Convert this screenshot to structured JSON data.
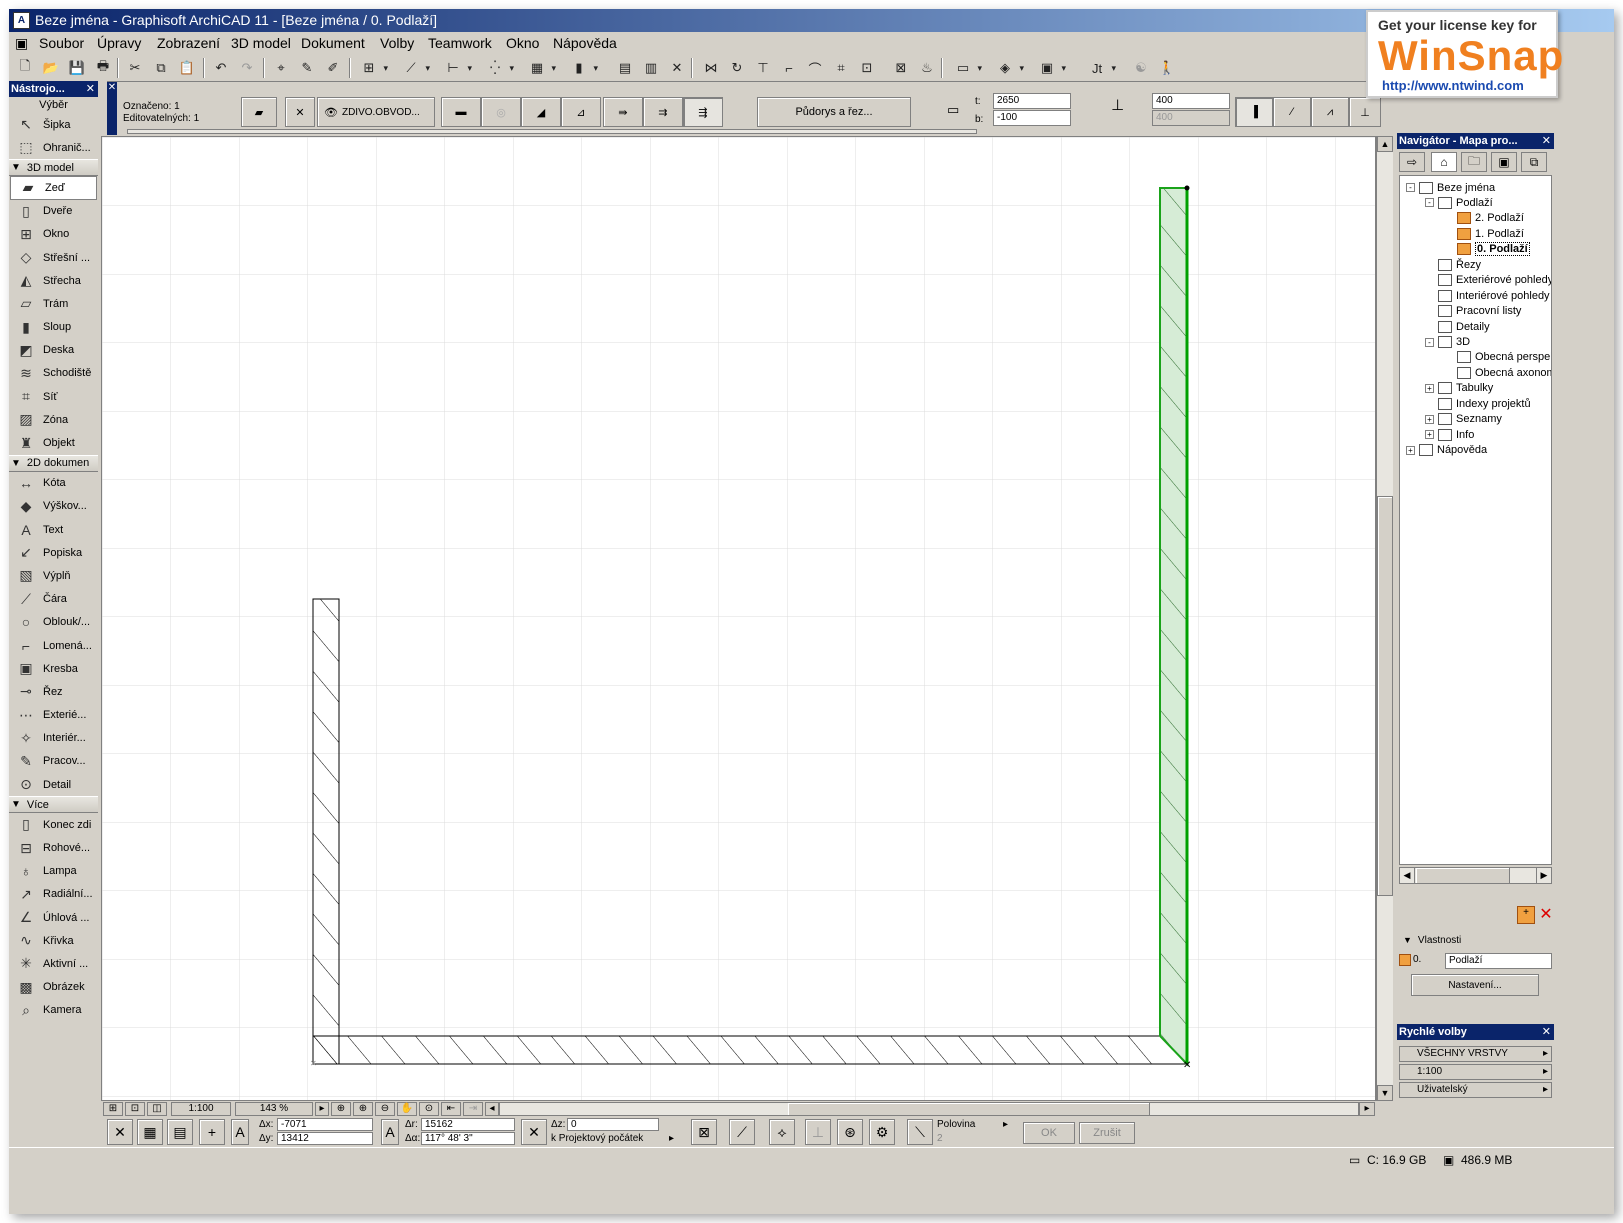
{
  "window": {
    "title": "Beze jména - Graphisoft ArchiCAD 11 - [Beze jména / 0. Podlaží]"
  },
  "menu": [
    "Soubor",
    "Úpravy",
    "Zobrazení",
    "3D model",
    "Dokument",
    "Volby",
    "Teamwork",
    "Okno",
    "Nápověda"
  ],
  "infobox": {
    "selected": "Označeno: 1",
    "editable": "Editovatelných: 1",
    "material": "ZDIVO.OBVOD...",
    "view_button": "Půdorys a řez...",
    "top_label": "t:",
    "top_value": "2650",
    "bottom_label": "b:",
    "bottom_value": "-100",
    "height_value": "400",
    "height_value2": "400"
  },
  "toolbox": {
    "title": "Nástrojo...",
    "select_label": "Výběr",
    "groups": {
      "selection": [
        {
          "label": "Šipka",
          "icon": "arrow-icon"
        },
        {
          "label": "Ohranič...",
          "icon": "marquee-icon"
        }
      ],
      "model_header": "3D model",
      "model": [
        {
          "label": "Zeď",
          "icon": "wall-icon",
          "selected": true
        },
        {
          "label": "Dveře",
          "icon": "door-icon"
        },
        {
          "label": "Okno",
          "icon": "window-icon"
        },
        {
          "label": "Střešní ...",
          "icon": "roof-window-icon"
        },
        {
          "label": "Střecha",
          "icon": "roof-icon"
        },
        {
          "label": "Trám",
          "icon": "beam-icon"
        },
        {
          "label": "Sloup",
          "icon": "column-icon"
        },
        {
          "label": "Deska",
          "icon": "slab-icon"
        },
        {
          "label": "Schodiště",
          "icon": "stair-icon"
        },
        {
          "label": "Síť",
          "icon": "mesh-icon"
        },
        {
          "label": "Zóna",
          "icon": "zone-icon"
        },
        {
          "label": "Objekt",
          "icon": "object-icon"
        }
      ],
      "doc_header": "2D dokumen",
      "doc": [
        {
          "label": "Kóta",
          "icon": "dimension-icon"
        },
        {
          "label": "Výškov...",
          "icon": "level-dimension-icon"
        },
        {
          "label": "Text",
          "icon": "text-icon"
        },
        {
          "label": "Popiska",
          "icon": "label-icon"
        },
        {
          "label": "Výplň",
          "icon": "fill-icon"
        },
        {
          "label": "Čára",
          "icon": "line-icon"
        },
        {
          "label": "Oblouk/...",
          "icon": "arc-icon"
        },
        {
          "label": "Lomená...",
          "icon": "polyline-icon"
        },
        {
          "label": "Kresba",
          "icon": "drawing-icon"
        },
        {
          "label": "Řez",
          "icon": "section-icon"
        },
        {
          "label": "Exterié...",
          "icon": "elevation-icon"
        },
        {
          "label": "Interiér...",
          "icon": "interior-elevation-icon"
        },
        {
          "label": "Pracov...",
          "icon": "worksheet-icon"
        },
        {
          "label": "Detail",
          "icon": "detail-icon"
        }
      ],
      "more_header": "Více",
      "more": [
        {
          "label": "Konec zdi",
          "icon": "wall-end-icon"
        },
        {
          "label": "Rohové...",
          "icon": "corner-window-icon"
        },
        {
          "label": "Lampa",
          "icon": "lamp-icon"
        },
        {
          "label": "Radiální...",
          "icon": "radial-dimension-icon"
        },
        {
          "label": "Úhlová ...",
          "icon": "angle-dimension-icon"
        },
        {
          "label": "Křivka",
          "icon": "spline-icon"
        },
        {
          "label": "Aktivní ...",
          "icon": "hotspot-icon"
        },
        {
          "label": "Obrázek",
          "icon": "picture-icon"
        },
        {
          "label": "Kamera",
          "icon": "camera-icon"
        }
      ]
    }
  },
  "statusbar": {
    "scale": "1:100",
    "zoom": "143 %"
  },
  "controlbox": {
    "dx_label": "Δx:",
    "dx": "-7071",
    "dy_label": "Δy:",
    "dy": "13412",
    "dr_label": "Δr:",
    "dr": "15162",
    "da_label": "Δα:",
    "da": "117° 48' 3\"",
    "dz_label": "Δz:",
    "dz": "0",
    "origin": "k Projektový počátek",
    "half": "Polovina",
    "half_num": "2",
    "ok": "OK",
    "cancel": "Zrušit"
  },
  "winstatus": {
    "disk": "C: 16.9 GB",
    "memory": "486.9 MB"
  },
  "navigator": {
    "title": "Navigátor - Mapa pro...",
    "tree": [
      {
        "label": "Beze jména",
        "level": 0,
        "exp": "-",
        "icon": "house-icon"
      },
      {
        "label": "Podlaží",
        "level": 1,
        "exp": "-",
        "icon": "stories-icon"
      },
      {
        "label": "2. Podlaží",
        "level": 2,
        "exp": "",
        "icon": "story-icon",
        "folder": true
      },
      {
        "label": "1. Podlaží",
        "level": 2,
        "exp": "",
        "icon": "story-icon",
        "folder": true
      },
      {
        "label": "0. Podlaží",
        "level": 2,
        "exp": "",
        "icon": "story-icon",
        "folder": true,
        "selected": true
      },
      {
        "label": "Řezy",
        "level": 1,
        "exp": "",
        "icon": "sections-icon"
      },
      {
        "label": "Exteriérové pohledy",
        "level": 1,
        "exp": "",
        "icon": "elevations-icon"
      },
      {
        "label": "Interiérové pohledy",
        "level": 1,
        "exp": "",
        "icon": "interior-icon"
      },
      {
        "label": "Pracovní listy",
        "level": 1,
        "exp": "",
        "icon": "worksheets-icon"
      },
      {
        "label": "Detaily",
        "level": 1,
        "exp": "",
        "icon": "details-icon"
      },
      {
        "label": "3D",
        "level": 1,
        "exp": "-",
        "icon": "3d-icon"
      },
      {
        "label": "Obecná perspektiva",
        "level": 2,
        "exp": "",
        "icon": "camera-icon"
      },
      {
        "label": "Obecná axonometrie",
        "level": 2,
        "exp": "",
        "icon": "cube-icon"
      },
      {
        "label": "Tabulky",
        "level": 1,
        "exp": "+",
        "icon": "table-icon"
      },
      {
        "label": "Indexy projektů",
        "level": 1,
        "exp": "",
        "icon": "index-icon"
      },
      {
        "label": "Seznamy",
        "level": 1,
        "exp": "+",
        "icon": "list-icon"
      },
      {
        "label": "Info",
        "level": 1,
        "exp": "+",
        "icon": "info-icon"
      },
      {
        "label": "Nápověda",
        "level": 0,
        "exp": "+",
        "icon": "help-icon"
      }
    ],
    "props_header": "Vlastnosti",
    "props_num": "0.",
    "props_name": "Podlaží",
    "props_button": "Nastavení..."
  },
  "quick": {
    "title": "Rychlé volby",
    "layers": "VŠECHNY VRSTVY",
    "scale": "1:100",
    "user": "Uživatelský"
  },
  "winsnap": {
    "line1": "Get your license key for",
    "brand": "WinSnap",
    "url": "http://www.ntwind.com"
  }
}
